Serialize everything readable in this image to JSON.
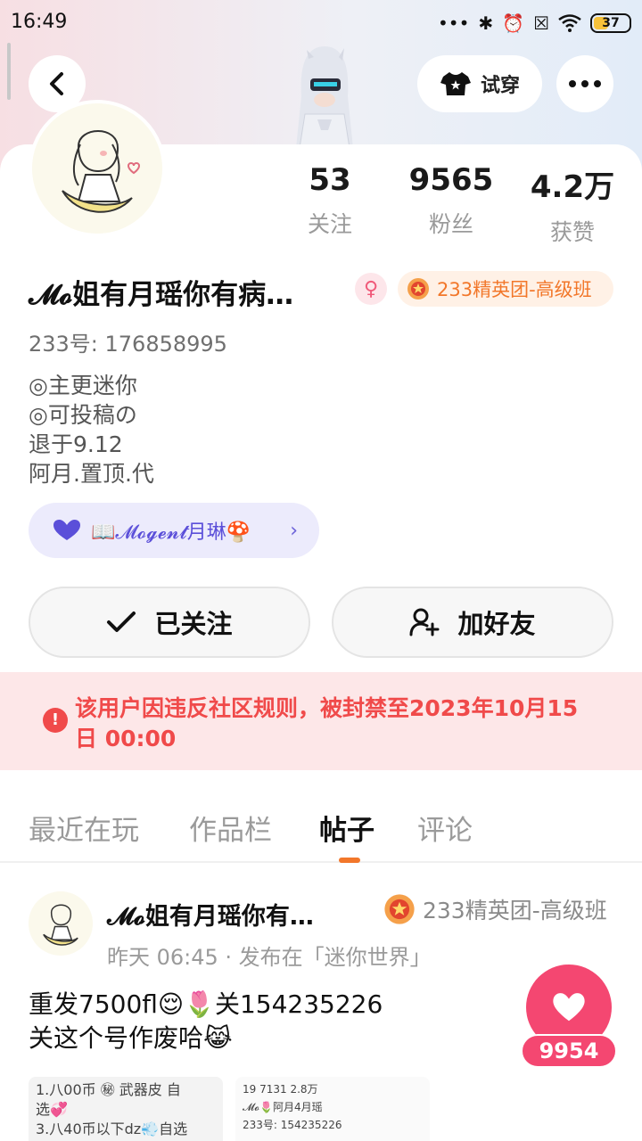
{
  "status_bar": {
    "time": "16:49",
    "battery": "37"
  },
  "header": {
    "try_on_label": "试穿"
  },
  "profile": {
    "stats": [
      {
        "value": "53",
        "label": "关注"
      },
      {
        "value": "9565",
        "label": "粉丝"
      },
      {
        "value": "4.2万",
        "label": "获赞"
      }
    ],
    "name": "𝓜𝓸姐有月瑶你有病…",
    "rank": "233精英团-高级班",
    "uid": "233号: 176858995",
    "bio": [
      "◎主更迷你",
      "◎可投稿の",
      "退于9.12",
      "阿月.置顶.代"
    ],
    "link_label": "📖𝓜𝓸𝓰𝓮𝓷𝓽月琳🍄"
  },
  "actions": {
    "followed_label": "已关注",
    "add_friend_label": "加好友"
  },
  "ban_notice": "该用户因违反社区规则，被封禁至2023年10月15日 00:00",
  "tabs": [
    "最近在玩",
    "作品栏",
    "帖子",
    "评论"
  ],
  "post": {
    "author": "𝓜𝓸姐有月瑶你有…",
    "rank": "233精英团-高级班",
    "meta": "昨天 06:45 · 发布在「迷你世界」",
    "lines": [
      "重发7500fl😌🌷关154235226",
      "关这个号作废哈😹"
    ],
    "like_count": "9954",
    "thumb1_lines": [
      "1.八00币 ㊙ 武器皮 自",
      "选💞",
      "3.八40币以下dz💨自选"
    ],
    "thumb2_lines": [
      "19   7131   2.8万",
      "𝓜𝓸🌷阿月4月瑶",
      "233号: 154235226"
    ]
  },
  "colors": {
    "accent": "#f2772a",
    "like": "#f44771",
    "ban": "#f04a4a",
    "link": "#5b4fd9"
  }
}
